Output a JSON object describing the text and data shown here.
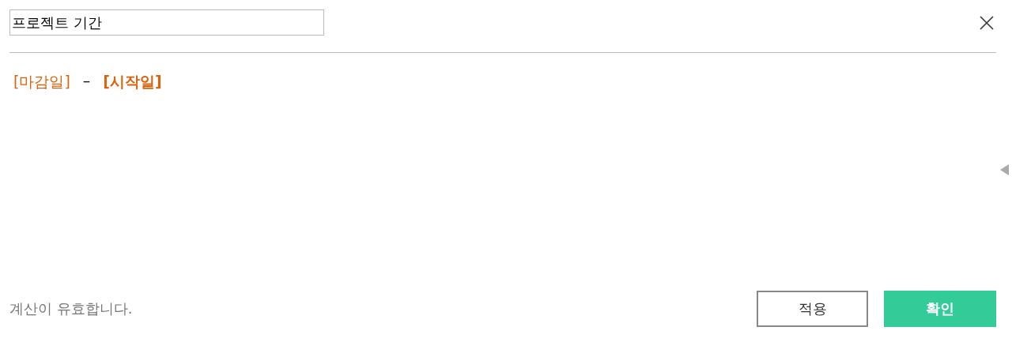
{
  "title_field": {
    "value": "프로젝트 기간"
  },
  "formula": [
    {
      "kind": "field",
      "text": "[마감일]",
      "bold": false
    },
    {
      "kind": "operator",
      "text": "–",
      "bold": false
    },
    {
      "kind": "field",
      "text": "[시작일]",
      "bold": true
    }
  ],
  "status": "계산이 유효합니다.",
  "buttons": [
    {
      "label": "적용",
      "kind": "secondary"
    },
    {
      "label": "확인",
      "kind": "primary"
    }
  ]
}
